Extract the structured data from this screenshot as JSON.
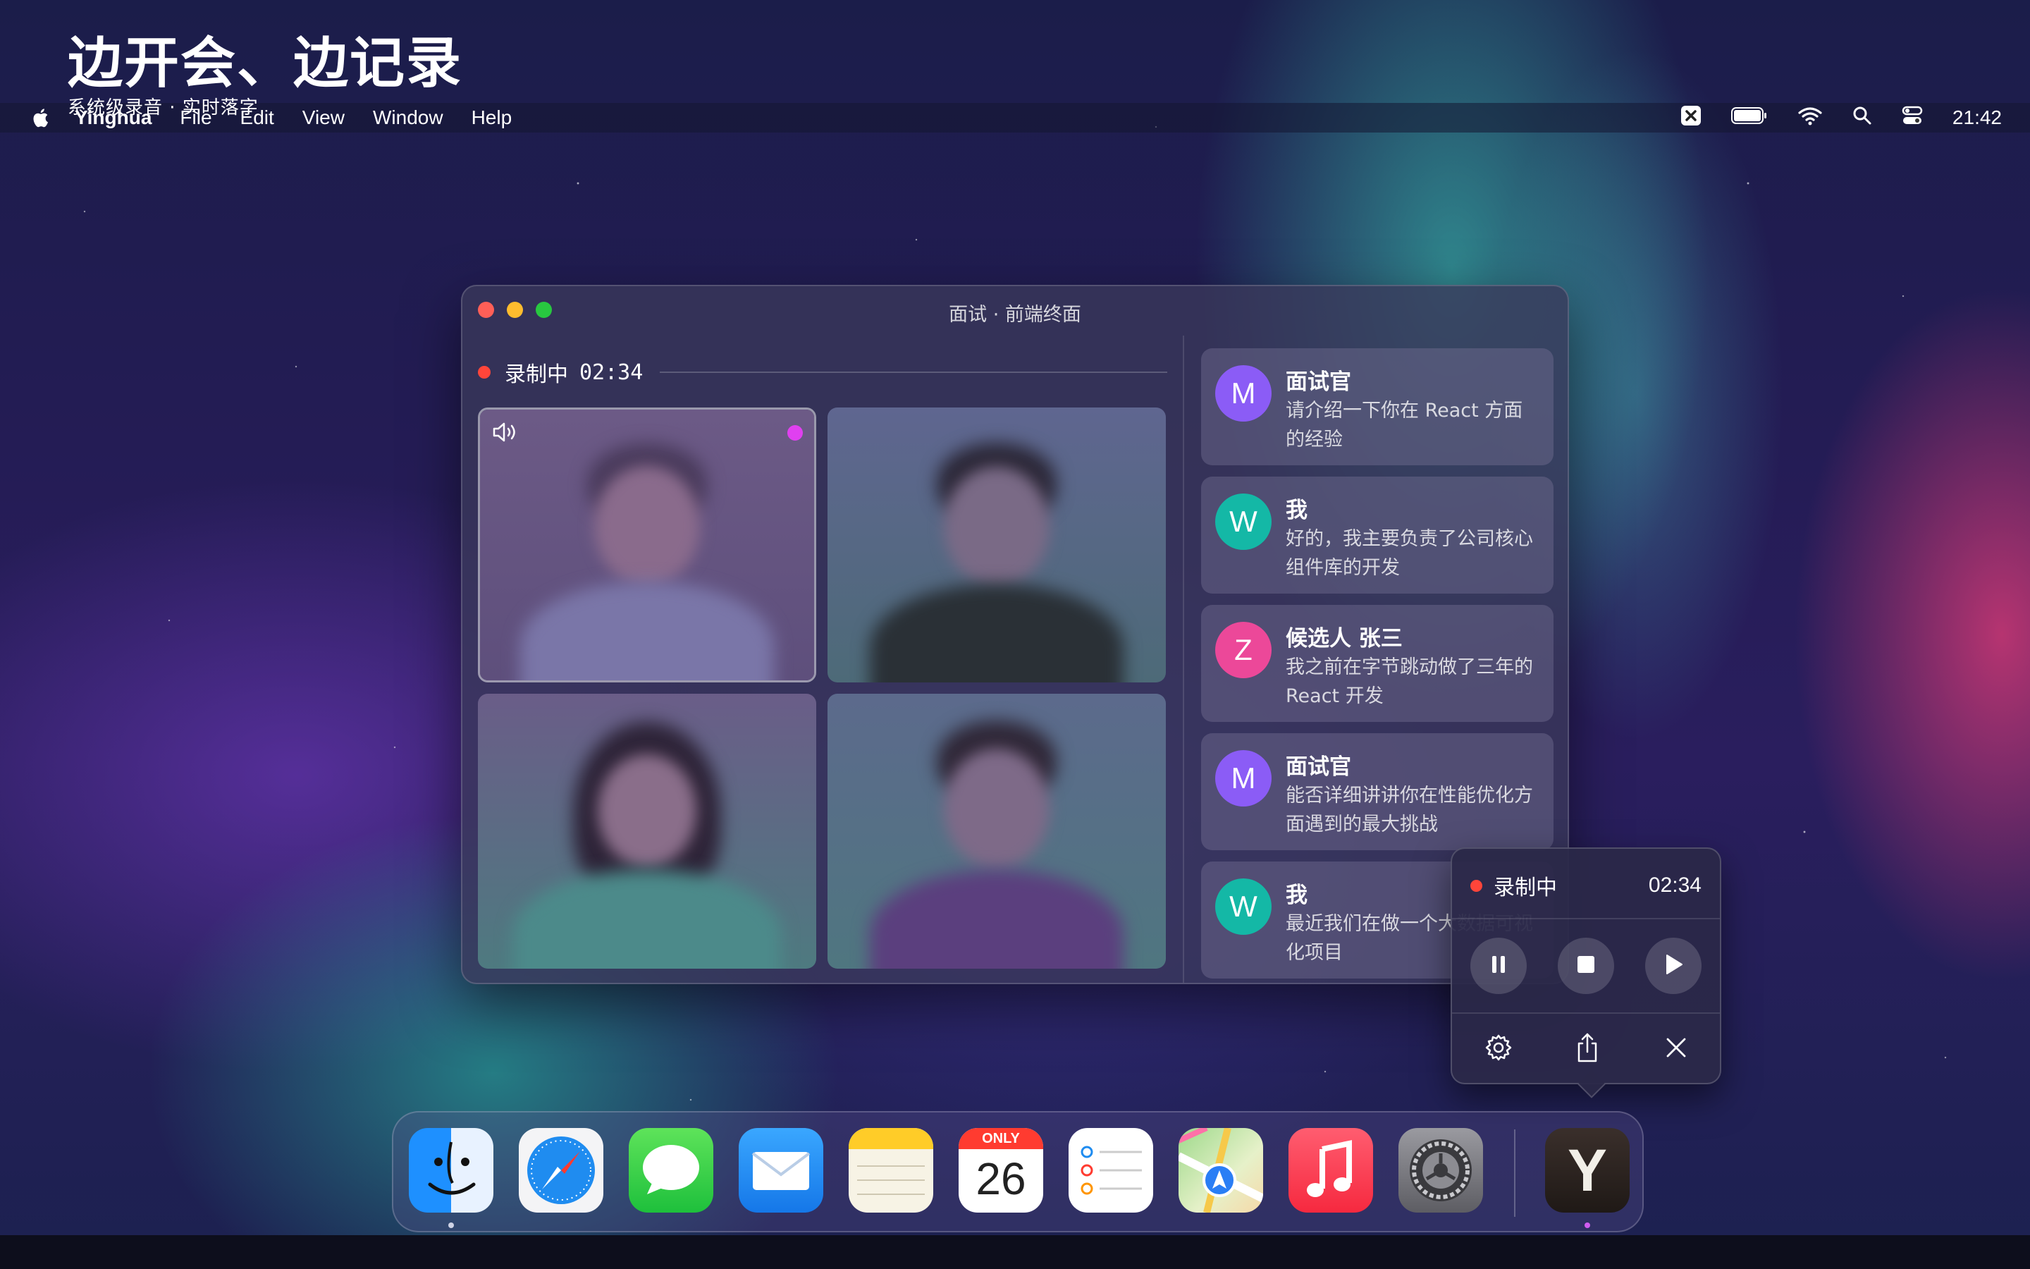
{
  "promo": {
    "title": "边开会、边记录",
    "subtitle": "系统级录音 · 实时落字"
  },
  "menubar": {
    "apple_icon": "apple-icon",
    "items": [
      "Yinghua",
      "File",
      "Edit",
      "View",
      "Window",
      "Help"
    ],
    "status_icons": [
      "app-status-icon",
      "battery-icon",
      "wifi-icon",
      "search-icon",
      "control-center-icon"
    ],
    "clock": "21:42"
  },
  "window": {
    "title": "面试 · 前端终面",
    "recording": {
      "label": "录制中",
      "time": "02:34"
    },
    "participants": [
      {
        "id": "p1",
        "speaking": true,
        "audio_icon": "speaker-icon"
      },
      {
        "id": "p2",
        "speaking": false
      },
      {
        "id": "p3",
        "speaking": false
      },
      {
        "id": "p4",
        "speaking": false
      }
    ],
    "transcript": [
      {
        "initial": "M",
        "name": "面试官",
        "text": "请介绍一下你在 React 方面的经验",
        "color": "#8b5cf6"
      },
      {
        "initial": "W",
        "name": "我",
        "text": "好的，我主要负责了公司核心组件库的开发",
        "color": "#14b8a6"
      },
      {
        "initial": "Z",
        "name": "候选人 张三",
        "text": "我之前在字节跳动做了三年的 React 开发",
        "color": "#ec4899"
      },
      {
        "initial": "M",
        "name": "面试官",
        "text": "能否详细讲讲你在性能优化方面遇到的最大挑战",
        "color": "#8b5cf6"
      },
      {
        "initial": "W",
        "name": "我",
        "text": "最近我们在做一个大数据可视化项目",
        "color": "#14b8a6"
      }
    ]
  },
  "floating_panel": {
    "label": "录制中",
    "time": "02:34",
    "controls": [
      "pause-icon",
      "stop-icon",
      "play-icon"
    ],
    "tools": [
      "gear-icon",
      "share-icon",
      "close-icon"
    ]
  },
  "dock": {
    "apps": [
      {
        "name": "finder-icon"
      },
      {
        "name": "safari-icon"
      },
      {
        "name": "messages-icon"
      },
      {
        "name": "mail-icon"
      },
      {
        "name": "notes-icon"
      },
      {
        "name": "calendar-icon",
        "month": "ONLY",
        "day": "26"
      },
      {
        "name": "reminders-icon"
      },
      {
        "name": "maps-icon"
      },
      {
        "name": "music-icon"
      },
      {
        "name": "system-settings-icon"
      },
      {
        "name": "yinghua-app-icon",
        "letter": "Y"
      }
    ]
  },
  "colors": {
    "record": "#ff453a",
    "speaking": "#e040f0",
    "accent": "#8b5cf6"
  }
}
